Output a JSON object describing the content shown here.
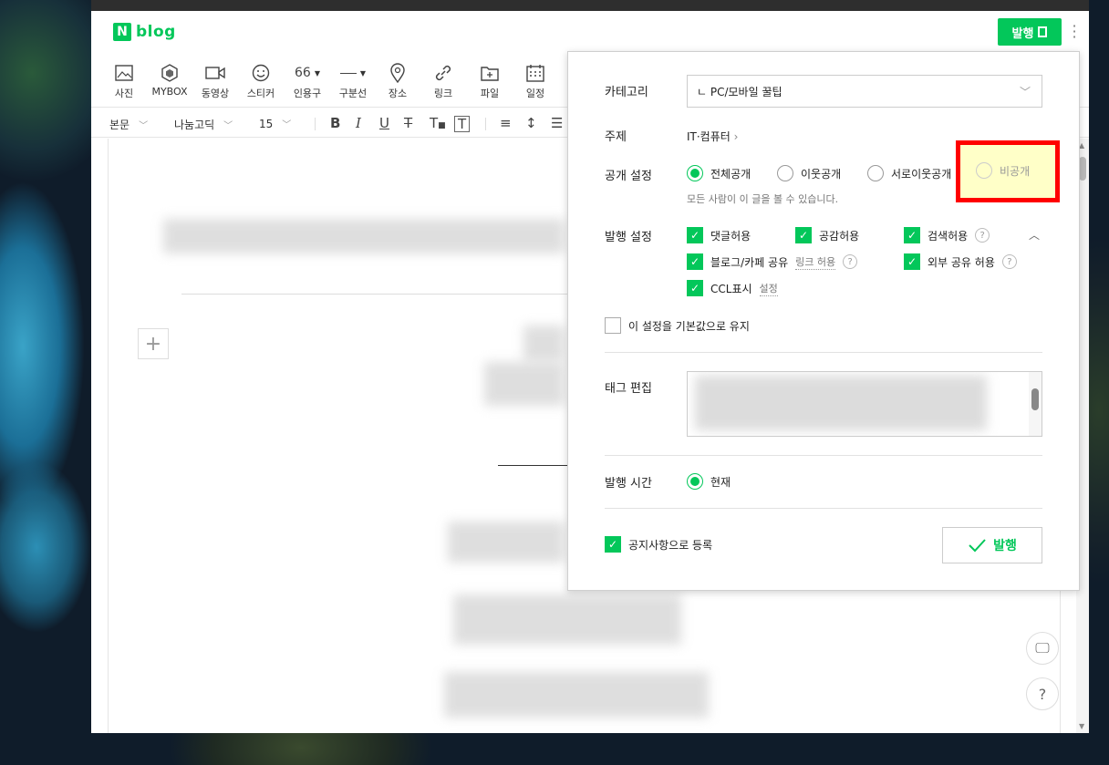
{
  "header": {
    "logo_letter": "N",
    "logo_text": "blog",
    "publish_label": "발행"
  },
  "toolbar": {
    "items": [
      {
        "label": "사진",
        "icon": "photo-icon"
      },
      {
        "label": "MYBOX",
        "icon": "mybox-icon"
      },
      {
        "label": "동영상",
        "icon": "video-icon"
      },
      {
        "label": "스티커",
        "icon": "sticker-icon"
      },
      {
        "label": "인용구",
        "icon": "quote-icon",
        "glyph": "66"
      },
      {
        "label": "구분선",
        "icon": "divider-icon"
      },
      {
        "label": "장소",
        "icon": "place-icon"
      },
      {
        "label": "링크",
        "icon": "link-icon"
      },
      {
        "label": "파일",
        "icon": "file-icon"
      },
      {
        "label": "일정",
        "icon": "calendar-icon"
      }
    ]
  },
  "format_bar": {
    "paragraph": "본문",
    "font": "나눔고딕",
    "size": "15"
  },
  "panel": {
    "category": {
      "label": "카테고리",
      "value": "ㄴ PC/모바일 꿀팁"
    },
    "topic": {
      "label": "주제",
      "value": "IT·컴퓨터"
    },
    "visibility": {
      "label": "공개 설정",
      "options": [
        "전체공개",
        "이웃공개",
        "서로이웃공개",
        "비공개"
      ],
      "selected": "전체공개",
      "note": "모든 사람이 이 글을 볼 수 있습니다."
    },
    "publish_settings": {
      "label": "발행 설정",
      "comments": "댓글허용",
      "likes": "공감허용",
      "search": "검색허용",
      "share": "블로그/카페 공유",
      "share_sub": "링크 허용",
      "external": "외부 공유 허용",
      "ccl": "CCL표시",
      "ccl_sub": "설정",
      "keep_default": "이 설정을 기본값으로 유지"
    },
    "tags": {
      "label": "태그 편집"
    },
    "time": {
      "label": "발행 시간",
      "value": "현재"
    },
    "notice": "공지사항으로 등록",
    "publish_button": "발행"
  }
}
